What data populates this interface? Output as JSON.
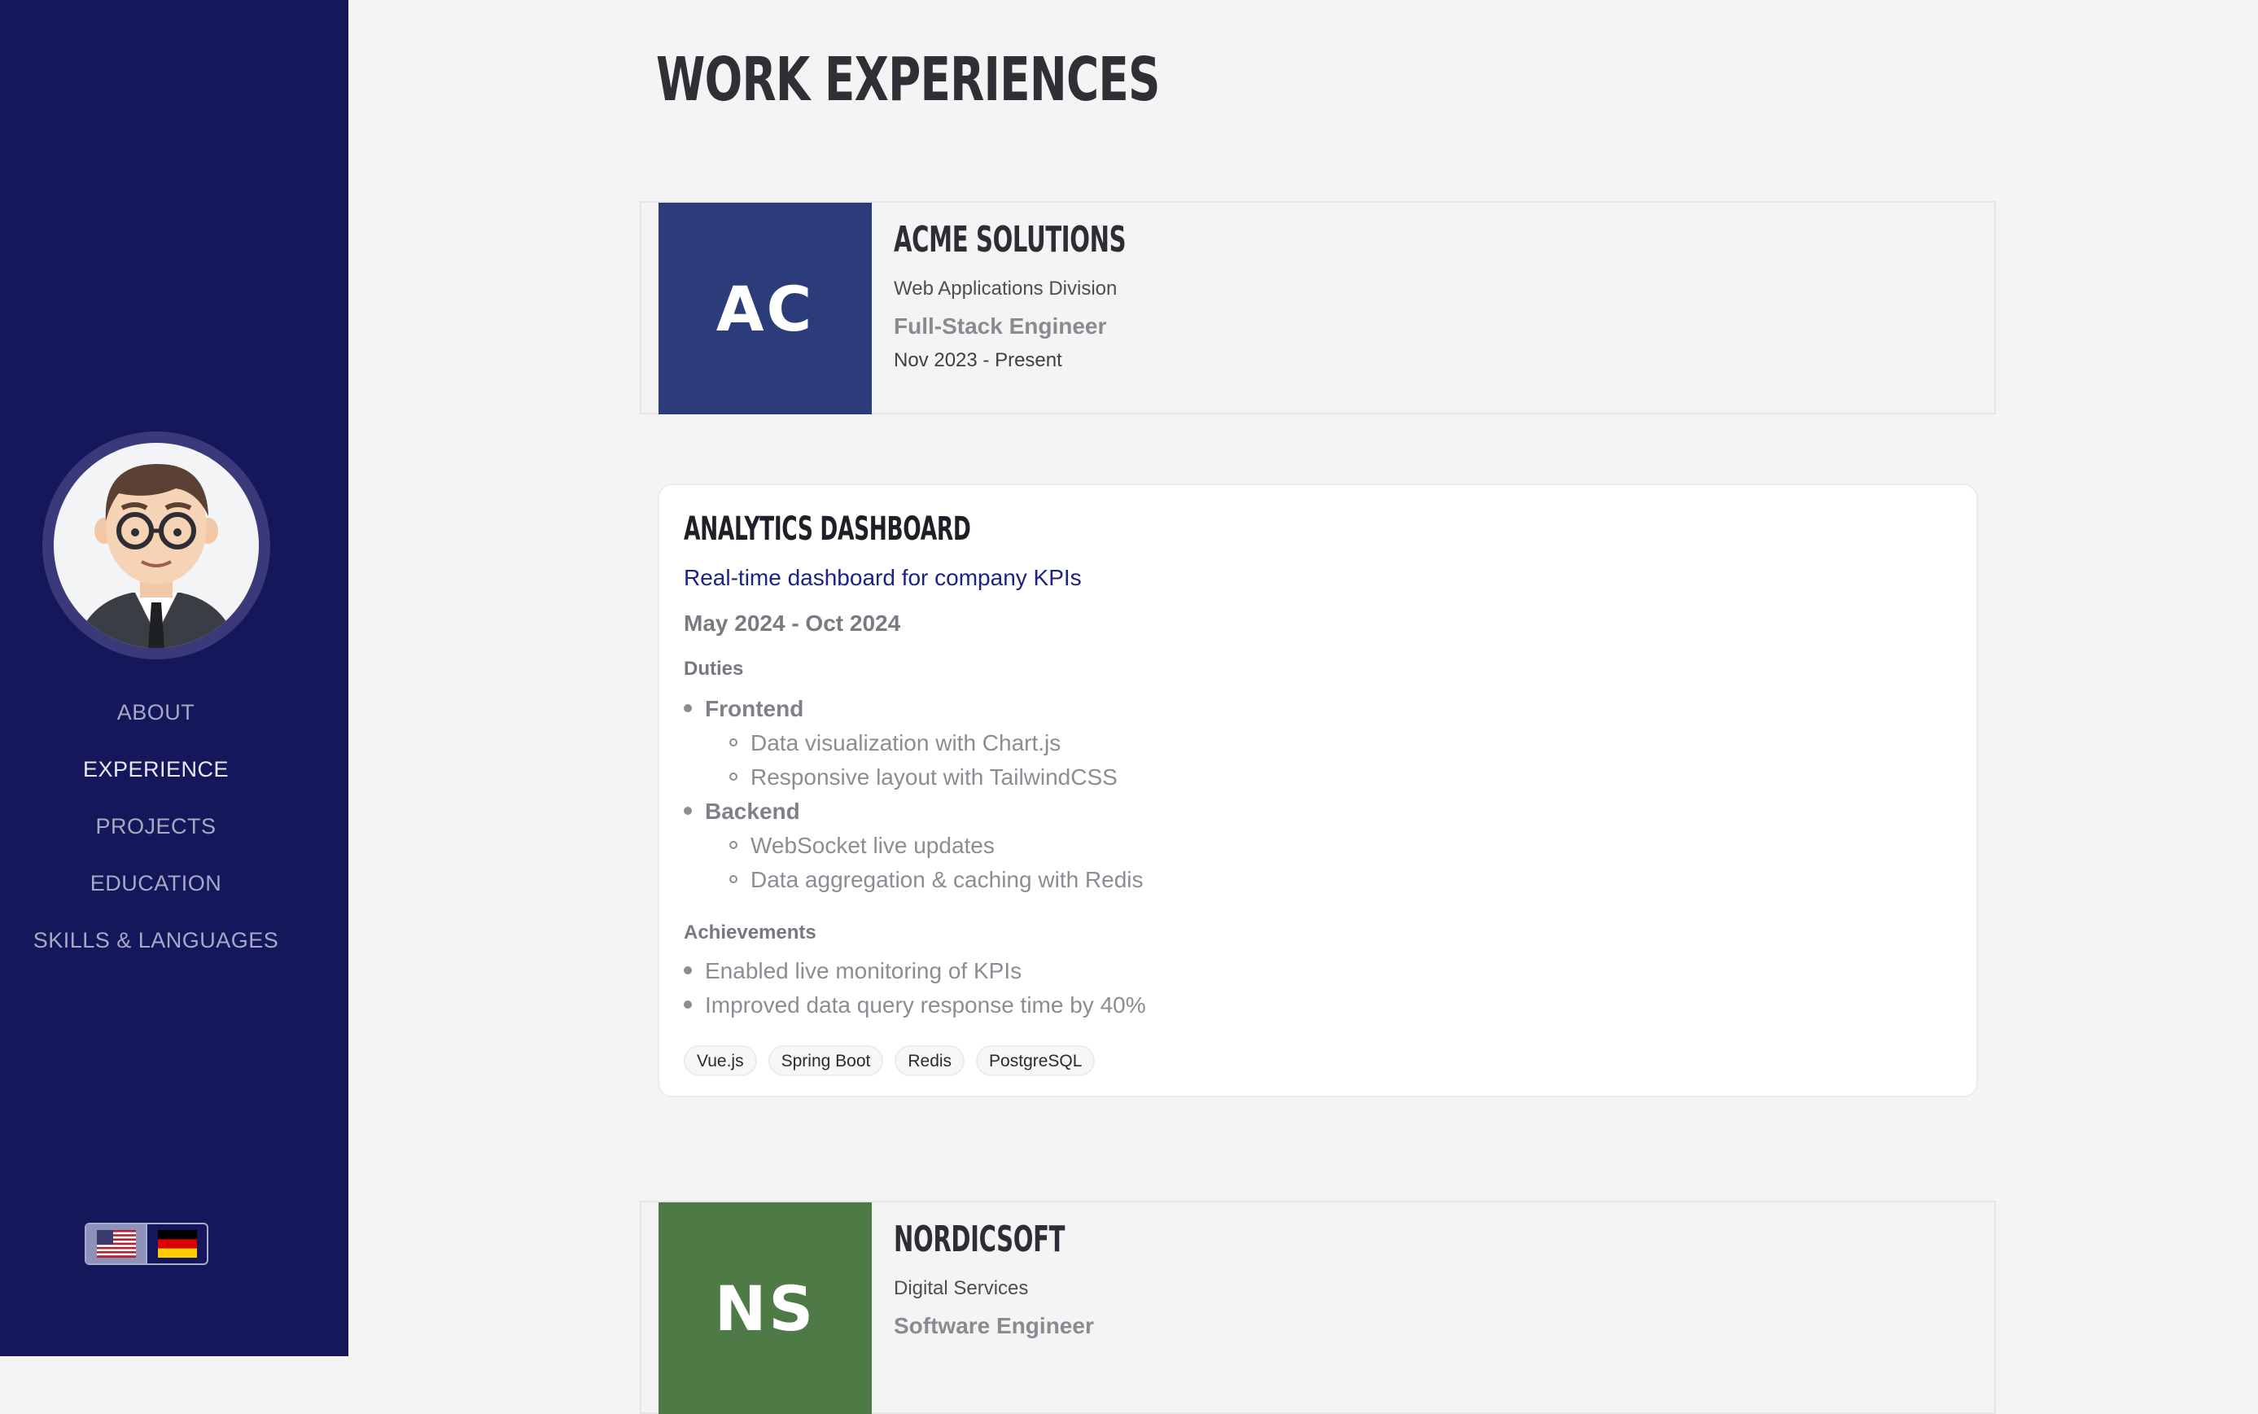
{
  "sidebar": {
    "nav": [
      {
        "label": "ABOUT",
        "active": false
      },
      {
        "label": "EXPERIENCE",
        "active": true
      },
      {
        "label": "PROJECTS",
        "active": false
      },
      {
        "label": "EDUCATION",
        "active": false
      },
      {
        "label": "SKILLS & LANGUAGES",
        "active": false
      }
    ],
    "languages": [
      "us-flag-icon",
      "de-flag-icon"
    ],
    "background": "#14185a"
  },
  "main": {
    "title": "WORK EXPERIENCES",
    "companies": [
      {
        "logo_text": "AC",
        "logo_color": "#2c3b7a",
        "name": "ACME SOLUTIONS",
        "division": "Web Applications Division",
        "role": "Full-Stack Engineer",
        "dates": "Nov 2023 - Present"
      },
      {
        "logo_text": "NS",
        "logo_color": "#4e7a46",
        "name": "NORDICSOFT",
        "division": "Digital Services",
        "role": "Software Engineer",
        "dates": ""
      }
    ],
    "project": {
      "title": "ANALYTICS DASHBOARD",
      "subtitle": "Real-time dashboard for company KPIs",
      "dates": "May 2024 - Oct 2024",
      "duties_label": "Duties",
      "duties": [
        {
          "label": "Frontend",
          "items": [
            "Data visualization with Chart.js",
            "Responsive layout with TailwindCSS"
          ]
        },
        {
          "label": "Backend",
          "items": [
            "WebSocket live updates",
            "Data aggregation & caching with Redis"
          ]
        }
      ],
      "achievements_label": "Achievements",
      "achievements": [
        "Enabled live monitoring of KPIs",
        "Improved data query response time by 40%"
      ],
      "tags": [
        "Vue.js",
        "Spring Boot",
        "Redis",
        "PostgreSQL"
      ]
    }
  }
}
